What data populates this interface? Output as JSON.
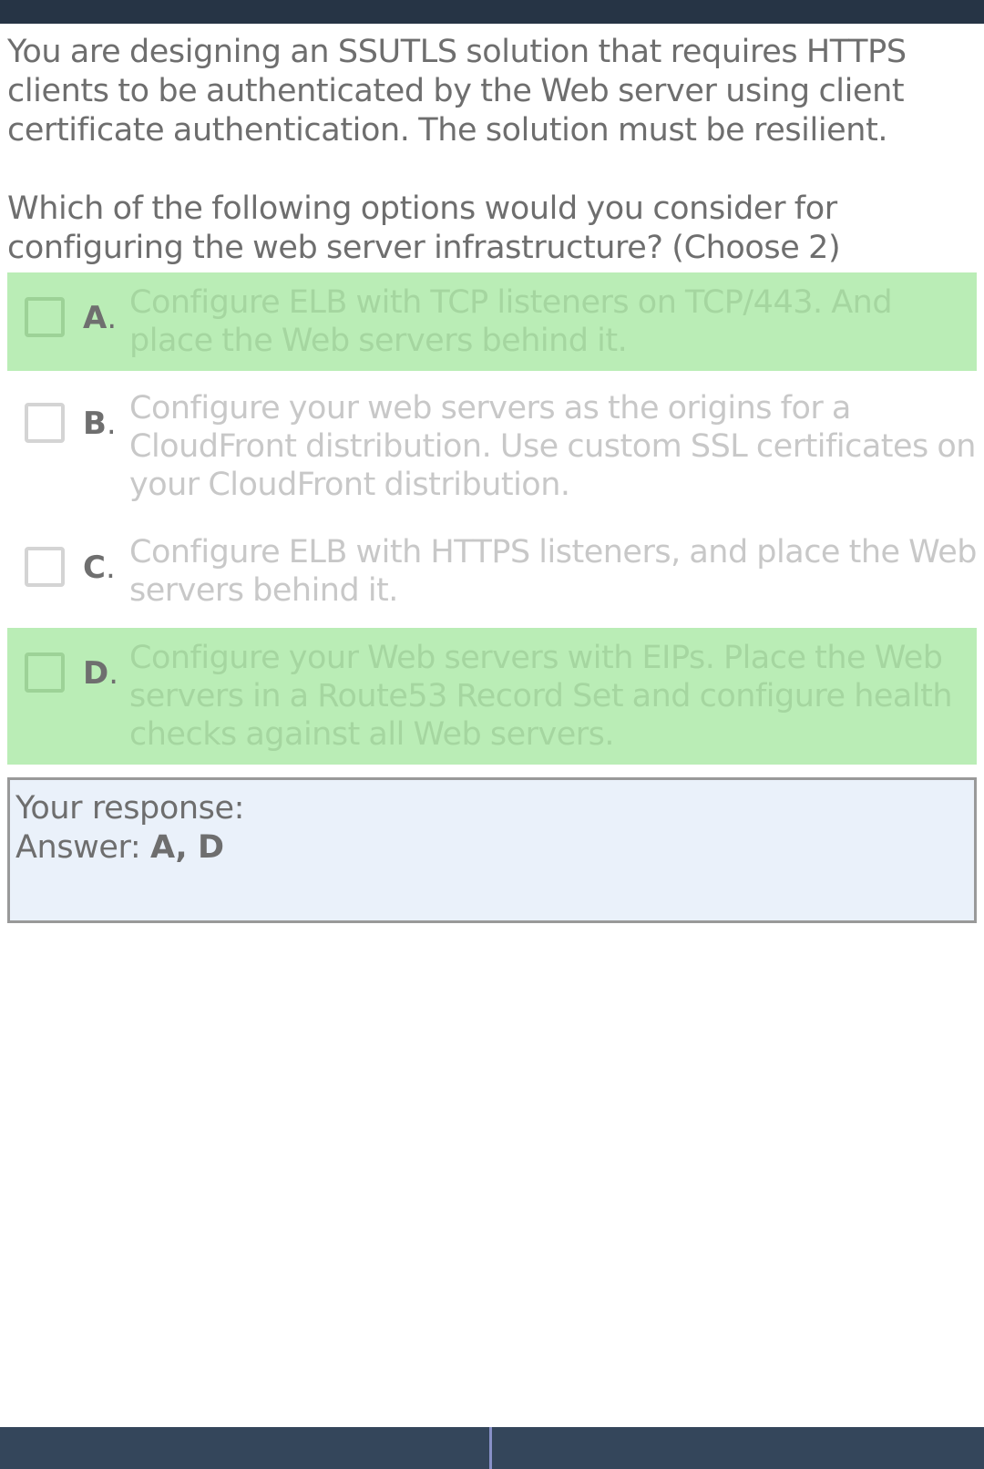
{
  "question": {
    "paragraph1": "You are designing an SSUTLS solution that requires HTTPS clients to be authenticated by the Web server using client certificate authentication. The solution must be resilient.",
    "paragraph2": "Which of the following options would you consider for configuring the web server infrastructure? (Choose 2)"
  },
  "options": [
    {
      "letter": "A",
      "text": "Configure ELB with TCP listeners on TCP/443. And place the Web servers behind it.",
      "correct": true
    },
    {
      "letter": "B",
      "text": "Configure your web servers as the origins for a CloudFront distribution. Use custom SSL certificates on your CloudFront distribution.",
      "correct": false
    },
    {
      "letter": "C",
      "text": "Configure ELB with HTTPS listeners, and place the Web servers behind it.",
      "correct": false
    },
    {
      "letter": "D",
      "text": "Configure your Web servers with EIPs. Place the Web servers in a Route53 Record Set and configure health checks against all Web servers.",
      "correct": true
    }
  ],
  "response": {
    "label": "Your response:",
    "answer_label": "Answer:",
    "answer_value": "A, D"
  },
  "colors": {
    "top_bar": "#263445",
    "bottom_bar": "#34465b",
    "correct_highlight": "#baedb6",
    "response_background": "#eaf1fa"
  }
}
